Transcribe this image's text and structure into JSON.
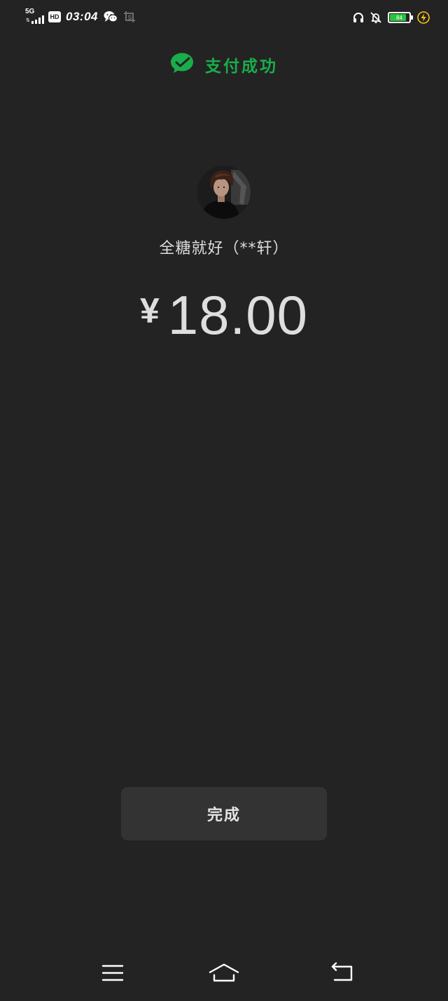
{
  "status_bar": {
    "network_type": "5G",
    "network_arrows": "⇅",
    "hd_badge": "HD",
    "time": "03:04",
    "battery_level": "84",
    "battery_percent": 84,
    "icons": [
      "signal-bars-icon",
      "wechat-icon",
      "screenshot-icon",
      "headphones-icon",
      "notifications-off-icon",
      "battery-icon",
      "charging-icon"
    ]
  },
  "header": {
    "icon": "wechat-pay-check-icon",
    "title": "支付成功"
  },
  "payee": {
    "name": "全糖就好（**轩）",
    "currency_symbol": "¥",
    "amount": "18.00"
  },
  "actions": {
    "done_label": "完成"
  },
  "nav_bar": {
    "icons": [
      "menu-icon",
      "home-icon",
      "back-icon"
    ]
  },
  "colors": {
    "background": "#232323",
    "accent_green": "#1aad4b",
    "button_bg": "#333333",
    "battery_fill": "#29c23e",
    "charging_yellow": "#f5c518"
  }
}
